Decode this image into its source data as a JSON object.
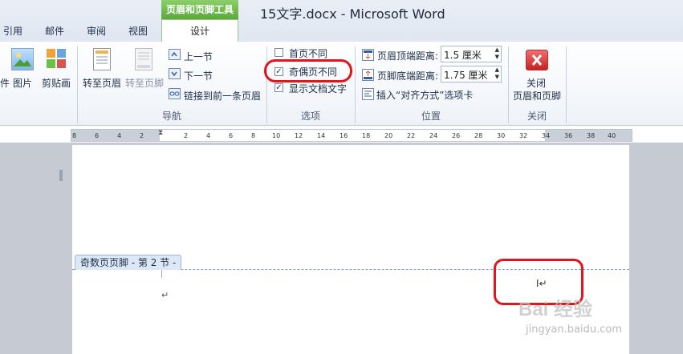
{
  "window": {
    "document_title": "15文字.docx - Microsoft Word",
    "contextual_tool_title": "页眉和页脚工具",
    "tabs": [
      "引用",
      "邮件",
      "审阅",
      "视图"
    ],
    "active_tab": "设计"
  },
  "ribbon": {
    "insert": {
      "partial_label": "件",
      "picture": "图片",
      "clipart": "剪贴画"
    },
    "navigation": {
      "goto_header": "转至页眉",
      "goto_footer": "转至页脚",
      "prev_section": "上一节",
      "next_section": "下一节",
      "link_previous": "链接到前一条页眉",
      "group_label": "导航"
    },
    "options": {
      "different_first_page": "首页不同",
      "different_odd_even": "奇偶页不同",
      "show_document_text": "显示文档文字",
      "group_label": "选项",
      "checked": {
        "different_first_page": false,
        "different_odd_even": true,
        "show_document_text": true
      }
    },
    "position": {
      "header_from_top_label": "页眉顶端距离:",
      "header_from_top_value": "1.5 厘米",
      "footer_from_bottom_label": "页脚底端距离:",
      "footer_from_bottom_value": "1.75 厘米",
      "insert_alignment_tab": "插入“对齐方式”选项卡",
      "group_label": "位置"
    },
    "close": {
      "line1": "关闭",
      "line2": "页眉和页脚",
      "group_label": "关闭"
    }
  },
  "ruler": {
    "ticks": [
      "8",
      "6",
      "4",
      "2",
      "2",
      "4",
      "6",
      "8",
      "10",
      "12",
      "14",
      "16",
      "18",
      "20",
      "22",
      "24",
      "26",
      "28",
      "30",
      "32",
      "34",
      "36",
      "38",
      "40"
    ]
  },
  "document": {
    "footer_tag": "奇数页页脚 - 第 2 节 -",
    "paragraph_mark": "↵",
    "cursor_mark": "I↵"
  },
  "watermark": {
    "brand": "Bai 经验",
    "url": "jingyan.baidu.com"
  },
  "colors": {
    "accent_green": "#5aa83a",
    "highlight_red": "#e3141b",
    "footer_dash": "#7da1d3"
  }
}
